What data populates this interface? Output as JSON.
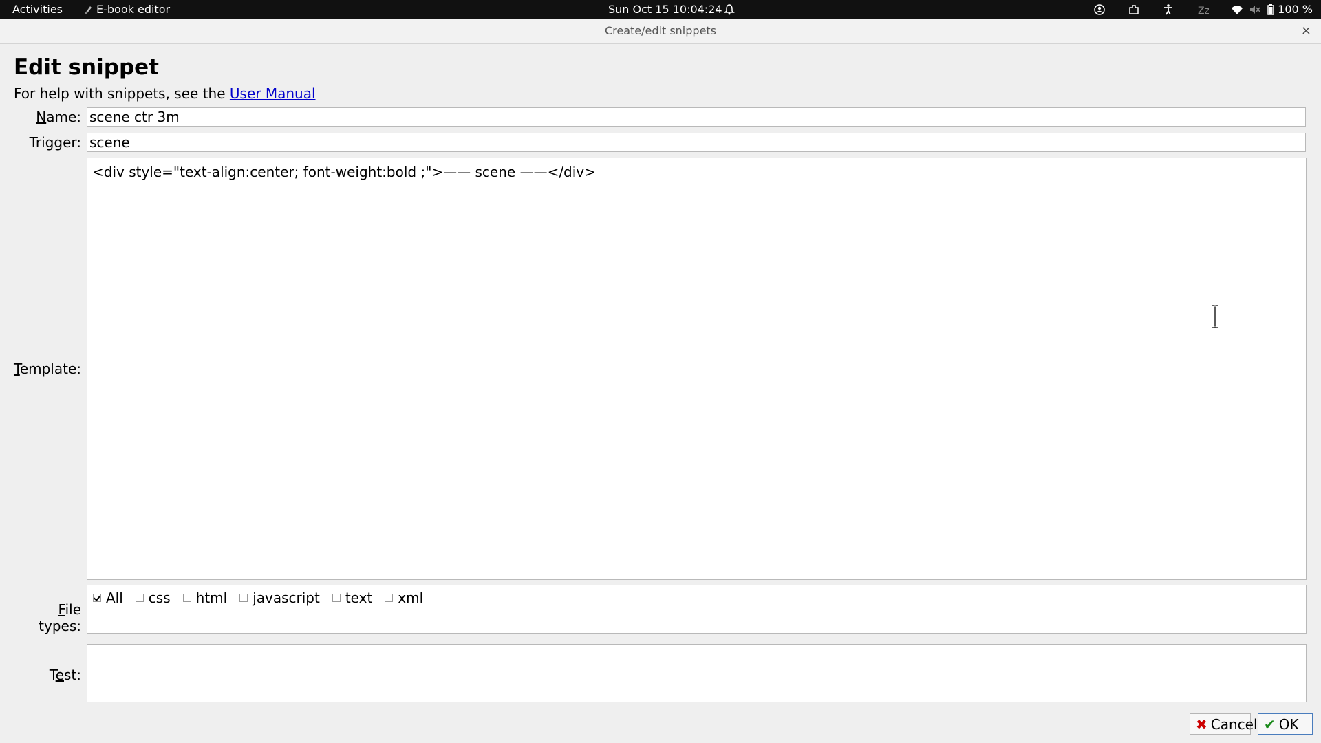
{
  "topbar": {
    "activities": "Activities",
    "app_name": "E-book editor",
    "clock": "Sun Oct 15  10:04:24",
    "battery": "100 %"
  },
  "dialog": {
    "title": "Create/edit snippets",
    "close": "×"
  },
  "page": {
    "heading": "Edit snippet",
    "help_prefix": "For help with snippets, see the ",
    "help_link": "User Manual"
  },
  "form": {
    "name_label_first": "N",
    "name_label_rest": "ame:",
    "name_value": "scene ctr 3m",
    "trigger_label": "Trigger:",
    "trigger_value": "scene",
    "template_label_first": "T",
    "template_label_rest": "emplate:",
    "template_value": "<div style=\"text-align:center; font-weight:bold ;\">—— scene ——</div>",
    "filetypes_label_first": "F",
    "filetypes_label_rest": "ile types:",
    "filetypes": [
      {
        "label": "All",
        "checked": true
      },
      {
        "label": "css",
        "checked": false
      },
      {
        "label": "html",
        "checked": false
      },
      {
        "label": "javascript",
        "checked": false
      },
      {
        "label": "text",
        "checked": false
      },
      {
        "label": "xml",
        "checked": false
      }
    ],
    "test_label_first": "T",
    "test_label_u": "e",
    "test_label_rest": "st:",
    "test_value": ""
  },
  "buttons": {
    "cancel": "Cancel",
    "ok": "OK"
  },
  "colors": {
    "link": "#0000cc",
    "cancel_icon": "#cc0000",
    "ok_icon": "#1a8a1a"
  }
}
